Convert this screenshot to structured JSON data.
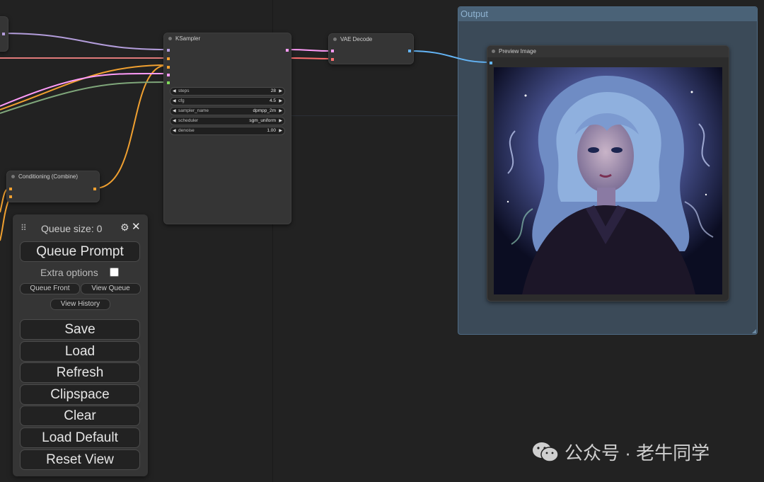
{
  "nodes": {
    "ksampler": {
      "title": "KSampler",
      "widgets": [
        {
          "label": "steps",
          "value": "28"
        },
        {
          "label": "cfg",
          "value": "4.5"
        },
        {
          "label": "sampler_name",
          "value": "dpmpp_2m"
        },
        {
          "label": "scheduler",
          "value": "sgm_uniform"
        },
        {
          "label": "denoise",
          "value": "1.00"
        }
      ]
    },
    "vae_decode": {
      "title": "VAE Decode"
    },
    "preview_image": {
      "title": "Preview Image"
    },
    "conditioning": {
      "title": "Conditioning (Combine)"
    }
  },
  "group": {
    "title": "Output"
  },
  "menu": {
    "queue_size": "Queue size: 0",
    "queue_prompt": "Queue Prompt",
    "extra_options": "Extra options",
    "queue_front": "Queue Front",
    "view_queue": "View Queue",
    "view_history": "View History",
    "save": "Save",
    "load": "Load",
    "refresh": "Refresh",
    "clipspace": "Clipspace",
    "clear": "Clear",
    "load_default": "Load Default",
    "reset_view": "Reset View",
    "settings_icon": "gear-icon",
    "close_icon": "close-icon"
  },
  "watermark": {
    "text": "公众号 · 老牛同学",
    "icon": "wechat-icon"
  },
  "colors": {
    "link_model": "#b39ddb",
    "link_positive": "#f0a030",
    "link_negative": "#e07a7a",
    "link_latent": "#ff9cf9",
    "link_image": "#64b5f6",
    "link_vae": "#ff6e6e",
    "group_bg": "#3b4a58",
    "canvas_bg": "#222222"
  }
}
